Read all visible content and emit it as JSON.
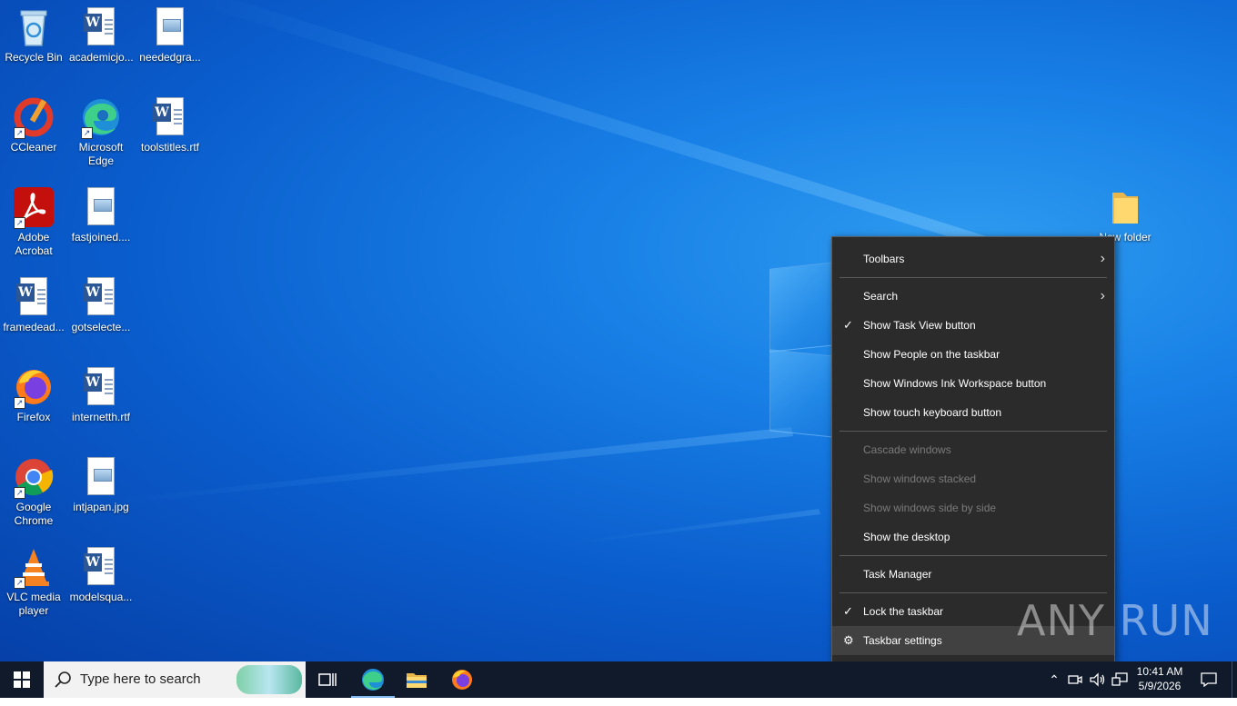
{
  "desktop": {
    "icons": [
      {
        "label": "Recycle Bin"
      },
      {
        "label": "academicjo..."
      },
      {
        "label": "neededgra..."
      },
      {
        "label": "CCleaner"
      },
      {
        "label": "Microsoft Edge"
      },
      {
        "label": "toolstitles.rtf"
      },
      {
        "label": "Adobe Acrobat"
      },
      {
        "label": "fastjoined...."
      },
      {
        "label": "framedead..."
      },
      {
        "label": "gotselecte..."
      },
      {
        "label": "Firefox"
      },
      {
        "label": "internetth.rtf"
      },
      {
        "label": "Google Chrome"
      },
      {
        "label": "intjapan.jpg"
      },
      {
        "label": "VLC media player"
      },
      {
        "label": "modelsqua..."
      },
      {
        "label": "New folder"
      }
    ]
  },
  "context_menu": {
    "items": [
      {
        "label": "Toolbars",
        "submenu": true
      },
      {
        "label": "Search",
        "submenu": true
      },
      {
        "label": "Show Task View button",
        "checked": true
      },
      {
        "label": "Show People on the taskbar"
      },
      {
        "label": "Show Windows Ink Workspace button"
      },
      {
        "label": "Show touch keyboard button"
      },
      {
        "label": "Cascade windows",
        "disabled": true
      },
      {
        "label": "Show windows stacked",
        "disabled": true
      },
      {
        "label": "Show windows side by side",
        "disabled": true
      },
      {
        "label": "Show the desktop"
      },
      {
        "label": "Task Manager"
      },
      {
        "label": "Lock the taskbar",
        "checked": true
      },
      {
        "label": "Taskbar settings",
        "icon": "gear-icon",
        "highlighted": true
      }
    ]
  },
  "taskbar": {
    "search_placeholder": "Type here to search",
    "time": "10:41 AM",
    "date": "5/9/2026"
  },
  "watermark": "ANY RUN"
}
